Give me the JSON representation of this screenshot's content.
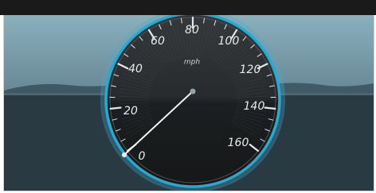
{
  "window": {
    "title": ""
  },
  "speedometer": {
    "unit_label": "mph",
    "scale_labels": [
      "0",
      "20",
      "40",
      "60",
      "80",
      "100",
      "120",
      "140",
      "160"
    ],
    "current_speed": 0,
    "accent_color": "#29a9cf",
    "needle_color": "#f2f2f2",
    "dial_color": "#202426"
  },
  "icons": {
    "needle": "needle-icon",
    "hub": "hub-icon"
  }
}
